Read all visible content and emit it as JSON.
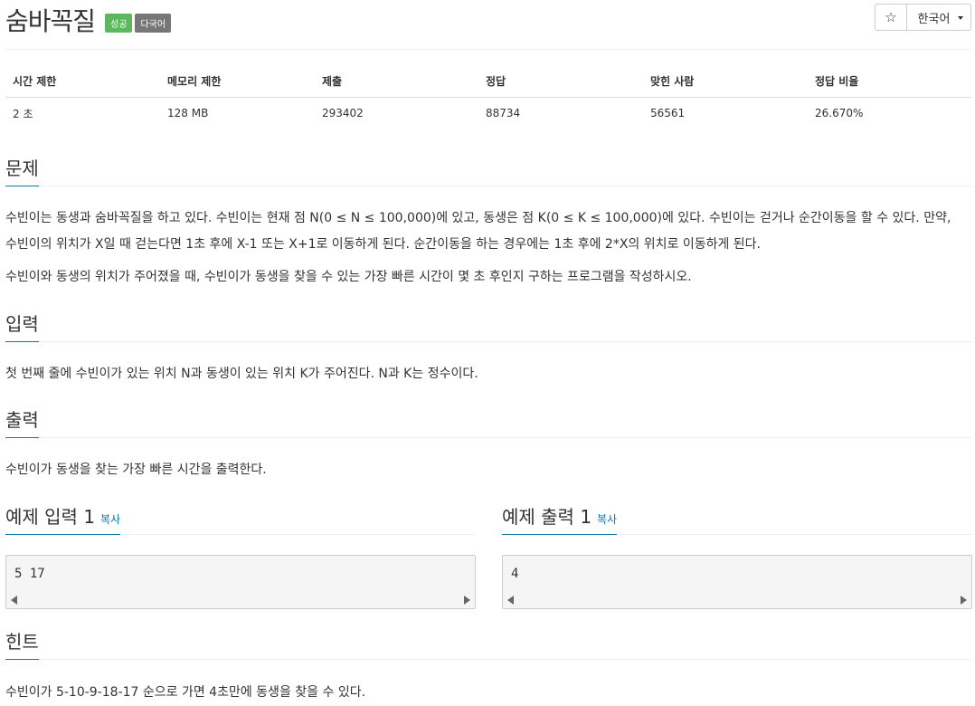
{
  "problem": {
    "title": "숨바꼭질",
    "labels": {
      "status": "성공",
      "multilang": "다국어"
    }
  },
  "toolbar": {
    "star_icon": "☆",
    "language": "한국어"
  },
  "info_table": {
    "headers": [
      "시간 제한",
      "메모리 제한",
      "제출",
      "정답",
      "맞힌 사람",
      "정답 비율"
    ],
    "values": [
      "2 초",
      "128 MB",
      "293402",
      "88734",
      "56561",
      "26.670%"
    ]
  },
  "sections": {
    "description": {
      "heading": "문제",
      "p1_line1": "수빈이는 동생과 숨바꼭질을 하고 있다. 수빈이는 현재 점 N(0 ≤ N ≤ 100,000)에 있고, 동생은 점 K(0 ≤ K ≤ 100,000)에 있다. 수빈이는 걷거나 순간이동을 할 수 있다. 만약,",
      "p1_line2": "수빈이의 위치가 X일 때 걷는다면 1초 후에 X-1 또는 X+1로 이동하게 된다. 순간이동을 하는 경우에는 1초 후에 2*X의 위치로 이동하게 된다.",
      "p2": "수빈이와 동생의 위치가 주어졌을 때, 수빈이가 동생을 찾을 수 있는 가장 빠른 시간이 몇 초 후인지 구하는 프로그램을 작성하시오."
    },
    "input": {
      "heading": "입력",
      "text": "첫 번째 줄에 수빈이가 있는 위치 N과 동생이 있는 위치 K가 주어진다. N과 K는 정수이다."
    },
    "output": {
      "heading": "출력",
      "text": "수빈이가 동생을 찾는 가장 빠른 시간을 출력한다."
    },
    "sample_input": {
      "heading": "예제 입력 1",
      "copy_label": "복사",
      "content": "5 17"
    },
    "sample_output": {
      "heading": "예제 출력 1",
      "copy_label": "복사",
      "content": "4"
    },
    "hint": {
      "heading": "힌트",
      "text": "수빈이가 5-10-9-18-17 순으로 가면 4초만에 동생을 찾을 수 있다."
    }
  },
  "colors": {
    "accent": "#0e76a8",
    "success": "#5cb85c",
    "default_label": "#777777"
  }
}
